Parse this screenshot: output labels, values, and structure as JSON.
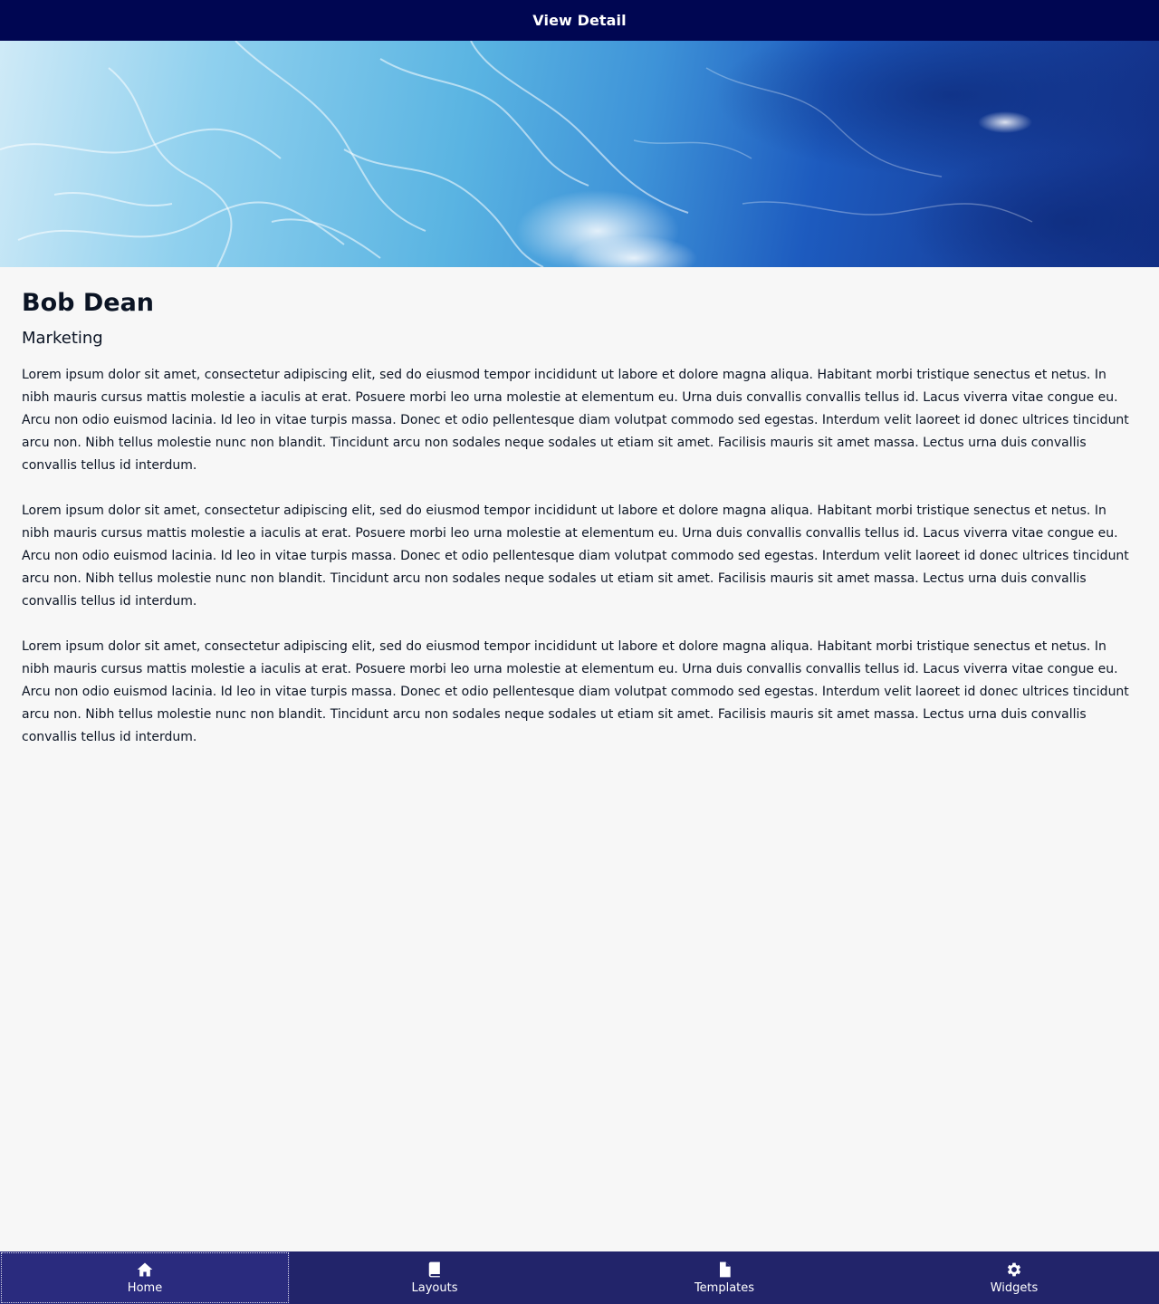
{
  "header": {
    "title": "View Detail"
  },
  "hero": {
    "image": "ocean-water-banner"
  },
  "profile": {
    "name": "Bob Dean",
    "department": "Marketing"
  },
  "paragraphs": [
    "Lorem ipsum dolor sit amet, consectetur adipiscing elit, sed do eiusmod tempor incididunt ut labore et dolore magna aliqua. Habitant morbi tristique senectus et netus. In nibh mauris cursus mattis molestie a iaculis at erat. Posuere morbi leo urna molestie at elementum eu. Urna duis convallis convallis tellus id. Lacus viverra vitae congue eu. Arcu non odio euismod lacinia. Id leo in vitae turpis massa. Donec et odio pellentesque diam volutpat commodo sed egestas. Interdum velit laoreet id donec ultrices tincidunt arcu non. Nibh tellus molestie nunc non blandit. Tincidunt arcu non sodales neque sodales ut etiam sit amet. Facilisis mauris sit amet massa. Lectus urna duis convallis convallis tellus id interdum.",
    "Lorem ipsum dolor sit amet, consectetur adipiscing elit, sed do eiusmod tempor incididunt ut labore et dolore magna aliqua. Habitant morbi tristique senectus et netus. In nibh mauris cursus mattis molestie a iaculis at erat. Posuere morbi leo urna molestie at elementum eu. Urna duis convallis convallis tellus id. Lacus viverra vitae congue eu. Arcu non odio euismod lacinia. Id leo in vitae turpis massa. Donec et odio pellentesque diam volutpat commodo sed egestas. Interdum velit laoreet id donec ultrices tincidunt arcu non. Nibh tellus molestie nunc non blandit. Tincidunt arcu non sodales neque sodales ut etiam sit amet. Facilisis mauris sit amet massa. Lectus urna duis convallis convallis tellus id interdum.",
    "Lorem ipsum dolor sit amet, consectetur adipiscing elit, sed do eiusmod tempor incididunt ut labore et dolore magna aliqua. Habitant morbi tristique senectus et netus. In nibh mauris cursus mattis molestie a iaculis at erat. Posuere morbi leo urna molestie at elementum eu. Urna duis convallis convallis tellus id. Lacus viverra vitae congue eu. Arcu non odio euismod lacinia. Id leo in vitae turpis massa. Donec et odio pellentesque diam volutpat commodo sed egestas. Interdum velit laoreet id donec ultrices tincidunt arcu non. Nibh tellus molestie nunc non blandit. Tincidunt arcu non sodales neque sodales ut etiam sit amet. Facilisis mauris sit amet massa. Lectus urna duis convallis convallis tellus id interdum."
  ],
  "tabbar": {
    "active": "Home",
    "tabs": [
      {
        "label": "Home",
        "icon": "home-icon"
      },
      {
        "label": "Layouts",
        "icon": "book-icon"
      },
      {
        "label": "Templates",
        "icon": "file-icon"
      },
      {
        "label": "Widgets",
        "icon": "gear-icon"
      }
    ]
  },
  "colors": {
    "header_bg": "#000652",
    "tabbar_bg": "#22246a",
    "tab_active_bg": "#2a2b7e",
    "page_bg": "#f7f7f7",
    "text": "#0b1424"
  }
}
